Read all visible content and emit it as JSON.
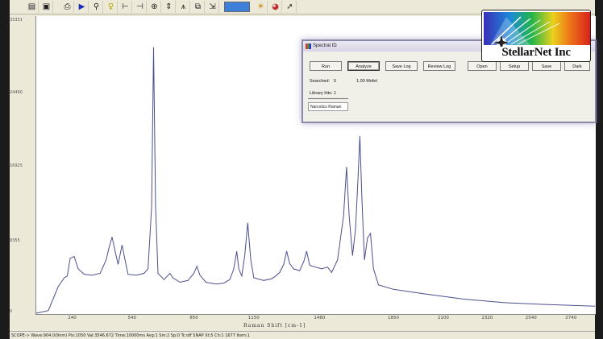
{
  "toolbar": {
    "icons": [
      "folder-open-icon",
      "save-icon",
      "print-icon",
      "play-icon",
      "pin-icon",
      "marker-icon",
      "cursor-left-icon",
      "cursor-right-icon",
      "zoom-icon",
      "scale-icon",
      "peaks-icon",
      "copy-icon",
      "export-icon",
      "color-bar",
      "sun-icon",
      "color-wheel-icon",
      "run-script-icon"
    ]
  },
  "chart_data": {
    "type": "line",
    "xlabel": "Raman Shift [cm-1]",
    "x_ticks": [
      240,
      540,
      850,
      1150,
      1480,
      1850,
      2100,
      2320,
      2540,
      2740
    ],
    "y_ticks": [
      "33331",
      "24490",
      "16925",
      "8355",
      "0"
    ],
    "xlim": [
      60,
      2860
    ],
    "ylim": [
      0,
      33331
    ],
    "series": [
      {
        "points": [
          [
            60,
            0
          ],
          [
            120,
            300
          ],
          [
            170,
            3000
          ],
          [
            200,
            4000
          ],
          [
            215,
            4200
          ],
          [
            230,
            6200
          ],
          [
            250,
            6400
          ],
          [
            270,
            5000
          ],
          [
            300,
            4400
          ],
          [
            340,
            4300
          ],
          [
            380,
            4500
          ],
          [
            410,
            6000
          ],
          [
            425,
            7400
          ],
          [
            440,
            8600
          ],
          [
            455,
            7000
          ],
          [
            470,
            5500
          ],
          [
            490,
            7700
          ],
          [
            505,
            6000
          ],
          [
            520,
            4400
          ],
          [
            560,
            4300
          ],
          [
            600,
            4500
          ],
          [
            620,
            5000
          ],
          [
            638,
            12000
          ],
          [
            648,
            30000
          ],
          [
            658,
            12000
          ],
          [
            670,
            4500
          ],
          [
            700,
            3800
          ],
          [
            730,
            4500
          ],
          [
            745,
            4000
          ],
          [
            780,
            3500
          ],
          [
            820,
            3700
          ],
          [
            850,
            4500
          ],
          [
            865,
            5300
          ],
          [
            880,
            4300
          ],
          [
            910,
            3500
          ],
          [
            960,
            3300
          ],
          [
            1000,
            3400
          ],
          [
            1030,
            3800
          ],
          [
            1050,
            5000
          ],
          [
            1065,
            7000
          ],
          [
            1075,
            5000
          ],
          [
            1090,
            4200
          ],
          [
            1105,
            6500
          ],
          [
            1120,
            10200
          ],
          [
            1135,
            6000
          ],
          [
            1150,
            4000
          ],
          [
            1200,
            3700
          ],
          [
            1240,
            3900
          ],
          [
            1260,
            4200
          ],
          [
            1280,
            4600
          ],
          [
            1300,
            5500
          ],
          [
            1315,
            7000
          ],
          [
            1330,
            5600
          ],
          [
            1350,
            5000
          ],
          [
            1380,
            4800
          ],
          [
            1400,
            5800
          ],
          [
            1415,
            7000
          ],
          [
            1430,
            5400
          ],
          [
            1460,
            5200
          ],
          [
            1490,
            5000
          ],
          [
            1520,
            5200
          ],
          [
            1540,
            4600
          ],
          [
            1570,
            6000
          ],
          [
            1600,
            11000
          ],
          [
            1615,
            16500
          ],
          [
            1628,
            11000
          ],
          [
            1645,
            6500
          ],
          [
            1660,
            9500
          ],
          [
            1672,
            15000
          ],
          [
            1682,
            20000
          ],
          [
            1692,
            13000
          ],
          [
            1705,
            6000
          ],
          [
            1720,
            8500
          ],
          [
            1735,
            9000
          ],
          [
            1750,
            5000
          ],
          [
            1775,
            3200
          ],
          [
            1850,
            2700
          ],
          [
            2000,
            2200
          ],
          [
            2200,
            1600
          ],
          [
            2400,
            1200
          ],
          [
            2600,
            1000
          ],
          [
            2860,
            800
          ]
        ],
        "color": "#4a4f8c"
      }
    ]
  },
  "dialog": {
    "title": "Spectral ID",
    "buttons": {
      "run": "Run",
      "analyze": "Analyze",
      "save_log": "Save Log",
      "review_log": "Review Log",
      "open": "Open",
      "setup": "Setup",
      "save": "Save",
      "dark": "Dark"
    },
    "searched_label": "Searched:",
    "searched_value": "5",
    "match_text": "1.00 Mofet",
    "library_label": "Library hits:",
    "library_value": "1",
    "library_name": "Narcotics Raman"
  },
  "logo": {
    "text": "StellarNet Inc"
  },
  "status_text": "SCOPE->  Wave:904.0(9nm)  Pix:1050  Val:3546.672  Time:10000ms  Avg:1  Sm:2  Sp:0  Tc:off  SNAP  Xt:5  Ch:1    1677 Item:1"
}
